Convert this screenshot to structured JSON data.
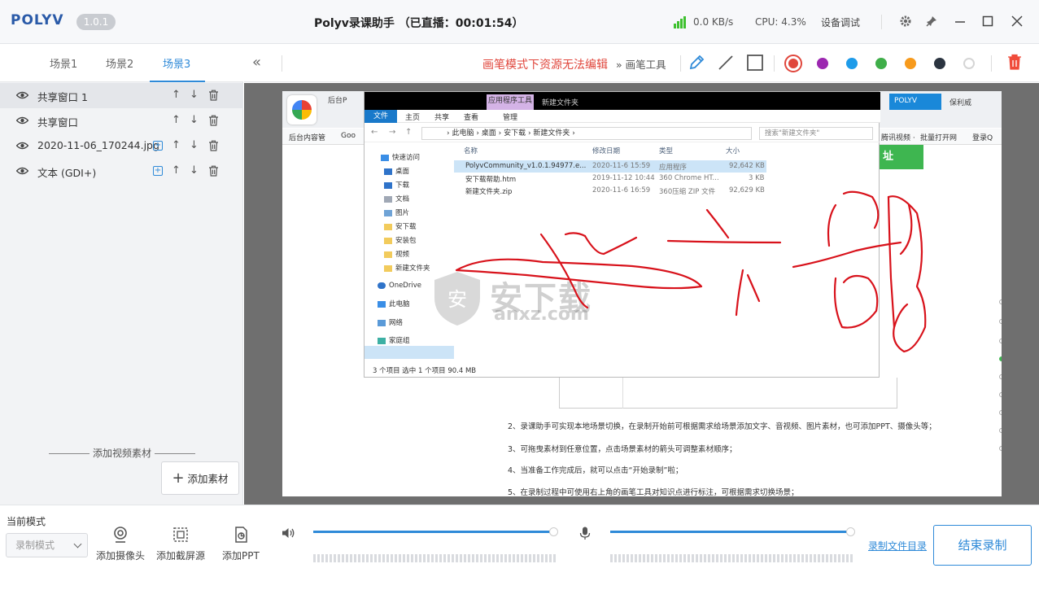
{
  "titlebar": {
    "logo": "POLYV",
    "version": "1.0.1",
    "title": "Polyv录课助手   （已直播：00:01:54）",
    "net_speed": "0.0 KB/s",
    "cpu": "CPU: 4.3%",
    "device_test": "设备调试",
    "icons": [
      "signal-icon",
      "gear-icon",
      "pin-icon",
      "minimize-icon",
      "maximize-icon",
      "close-icon"
    ]
  },
  "scenes": {
    "tabs": [
      "场景1",
      "场景2",
      "场景3"
    ],
    "active": "场景3"
  },
  "sources": [
    {
      "name": "共享窗口 1",
      "selected": true,
      "has_plus": false
    },
    {
      "name": "共享窗口",
      "selected": false,
      "has_plus": false
    },
    {
      "name": "2020-11-06_170244.jpg",
      "selected": false,
      "has_plus": true
    },
    {
      "name": "文本 (GDI+)",
      "selected": false,
      "has_plus": true
    }
  ],
  "left_footer": {
    "add_video_label": "添加视频素材",
    "add_material_label": "添加素材"
  },
  "toolbar": {
    "warning": "画笔模式下资源无法编辑",
    "pen_tools_label": "画笔工具",
    "colors": [
      "#e0463c",
      "#9c27b0",
      "#1e9be9",
      "#3fae49",
      "#f79a1c",
      "#2b3440",
      "#ffffff"
    ],
    "selected_color": "#e0463c"
  },
  "preview": {
    "browser": {
      "tabs": [
        "后台P",
        "POLYV",
        "保利威"
      ],
      "bookmarks": [
        "后台内容管",
        "Goo",
        "腾讯视频 ·",
        "批量打开网",
        "登录Q"
      ]
    },
    "explorer": {
      "context_tab": "应用程序工具",
      "context_title": "新建文件夹",
      "ribbon_tabs": [
        "文件",
        "主页",
        "共享",
        "查看",
        "管理"
      ],
      "breadcrumb": "› 此电脑 › 桌面 › 安下载 › 新建文件夹 ›",
      "search_placeholder": "搜索\"新建文件夹\"",
      "nav_items": [
        "快速访问",
        "桌面",
        "下载",
        "文档",
        "图片",
        "安下载",
        "安装包",
        "视频",
        "新建文件夹",
        "OneDrive",
        "此电脑",
        "网络",
        "家庭组"
      ],
      "columns": [
        "名称",
        "修改日期",
        "类型",
        "大小"
      ],
      "files": [
        {
          "name": "PolyvCommunity_v1.0.1.94977.e...",
          "date": "2020-11-6 15:59",
          "type": "应用程序",
          "size": "92,642 KB"
        },
        {
          "name": "安下载帮助.htm",
          "date": "2019-11-12 10:44",
          "type": "360 Chrome HT...",
          "size": "3 KB"
        },
        {
          "name": "新建文件夹.zip",
          "date": "2020-11-6 16:59",
          "type": "360压缩 ZIP 文件",
          "size": "92,629 KB"
        }
      ],
      "status": "3 个项目     选中 1 个项目  90.4 MB"
    },
    "green_banner": "址",
    "instructions": [
      "2、录课助手可实现本地场景切换，在录制开始前可根据需求给场景添加文字、音视频、图片素材，也可添加PPT、摄像头等；",
      "3、可拖曳素材到任意位置，点击场景素材的箭头可调整素材顺序；",
      "4、当准备工作完成后，就可以点击“开始录制”啦；",
      "5、在录制过程中可使用右上角的画笔工具对知识点进行标注，可根据需求切换场景；"
    ],
    "watermark": {
      "cn": "安下载",
      "en": "anxz.com"
    }
  },
  "bottom": {
    "mode_label": "当前模式",
    "mode_value": "录制模式",
    "add_camera": "添加摄像头",
    "add_screen": "添加截屏源",
    "add_ppt": "添加PPT",
    "speaker_volume": 1.0,
    "mic_volume": 1.0,
    "record_dir": "录制文件目录",
    "end_record": "结束录制"
  }
}
